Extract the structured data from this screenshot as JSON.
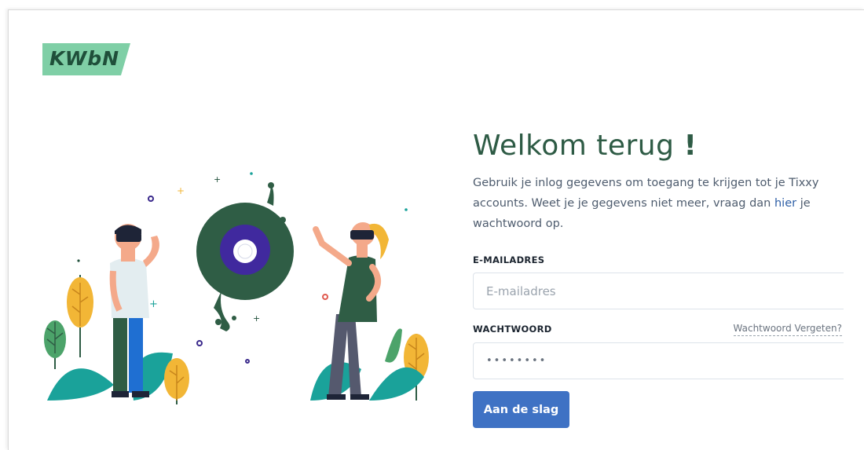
{
  "brand": {
    "logo_text": "KWbN",
    "logo_color": "#7fcfa6"
  },
  "login": {
    "title": "Welkom terug",
    "title_mark": "!",
    "intro_before_link": "Gebruik je inlog gegevens om toegang te krijgen tot je Tixxy accounts. Weet je je gegevens niet meer, vraag dan ",
    "intro_link": "hier",
    "intro_after_link": " je wachtwoord op.",
    "email": {
      "label": "E-MAILADRES",
      "placeholder": "E-mailadres",
      "value": ""
    },
    "password": {
      "label": "WACHTWOORD",
      "value": "••••••••",
      "forgot_link": "Wachtwoord Vergeten?"
    },
    "submit_label": "Aan de slag"
  },
  "colors": {
    "title": "#2e5b45",
    "button": "#3f72c4",
    "link": "#2e5fa6"
  }
}
